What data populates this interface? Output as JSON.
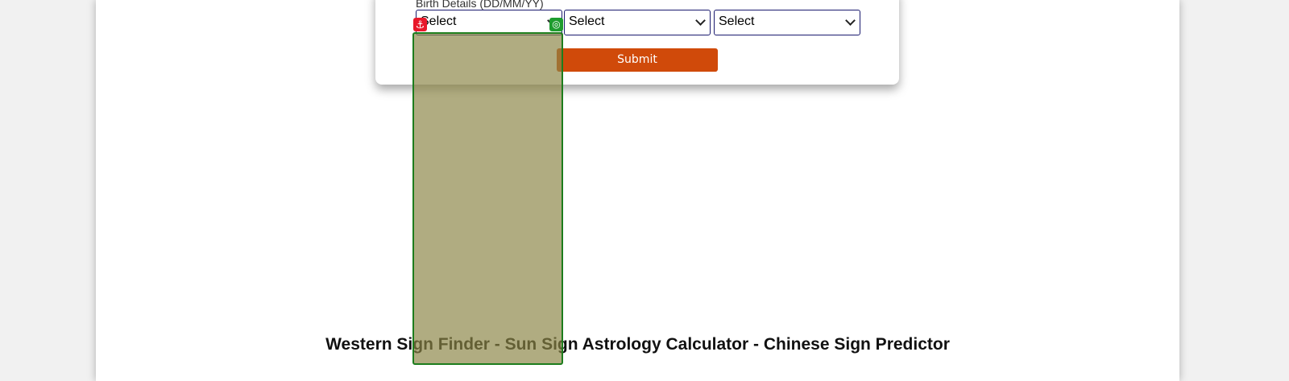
{
  "form": {
    "birth_label": "Birth Details (DD/MM/YY)",
    "day_select": {
      "selected": "Select"
    },
    "month_select": {
      "selected": "Select"
    },
    "year_select": {
      "selected": "Select"
    },
    "submit_label": "Submit"
  },
  "overlay": {
    "anchor_icon": "anchor-icon",
    "target_icon": "target-icon",
    "anchor_glyph": "⚓",
    "target_glyph": "◎"
  },
  "page": {
    "heading": "Western Sign Finder - Sun Sign Astrology Calculator - Chinese Sign Predictor"
  },
  "colors": {
    "background": "#f1f1f1",
    "submit_button": "#d04a0a",
    "select_border": "#1a1a6e",
    "overlay_fill": "#8b8446",
    "overlay_border": "#1d7d1d",
    "anchor_badge": "#e8182a",
    "target_badge": "#1d9c2e"
  }
}
